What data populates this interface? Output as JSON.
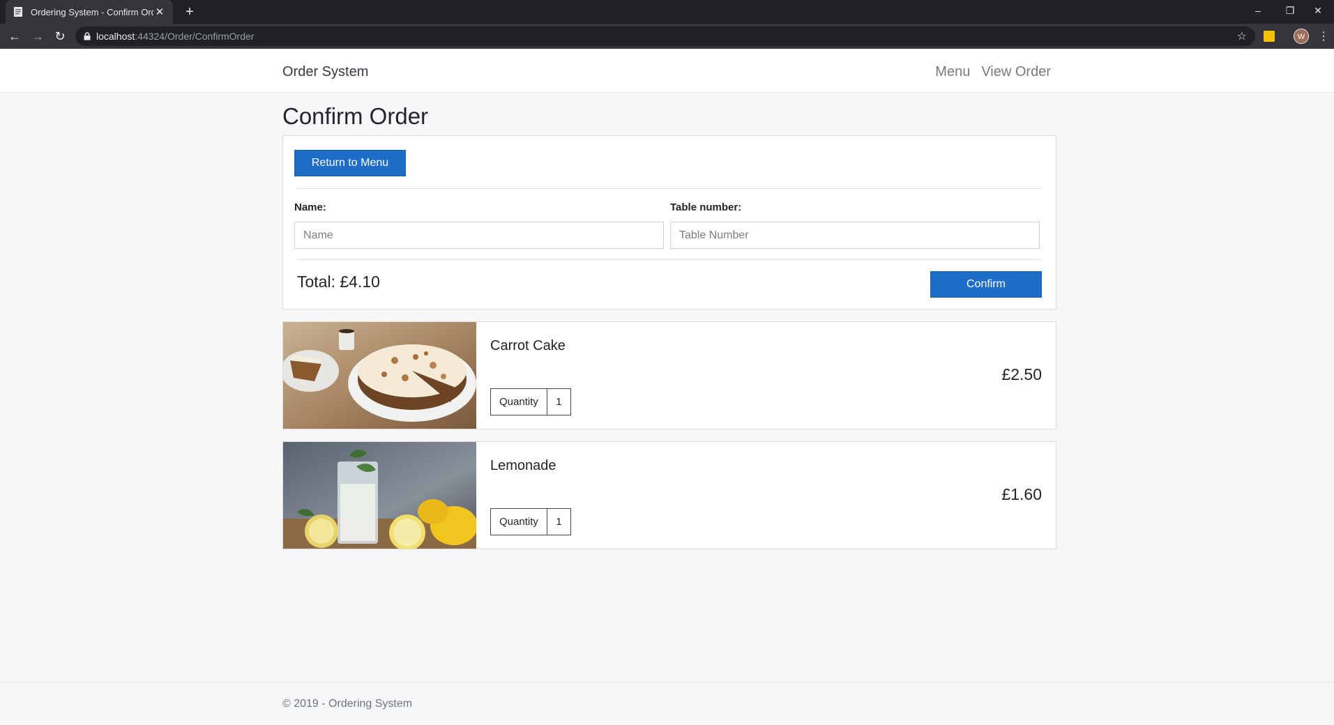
{
  "browser": {
    "tab_title": "Ordering System - Confirm Order",
    "url_host": "localhost",
    "url_rest": ":44324/Order/ConfirmOrder",
    "profile_initial": "W"
  },
  "navbar": {
    "brand": "Order System",
    "links": [
      "Menu",
      "View Order"
    ]
  },
  "page": {
    "title": "Confirm Order",
    "return_button": "Return to Menu",
    "name_label": "Name:",
    "name_placeholder": "Name",
    "table_label": "Table number:",
    "table_placeholder": "Table Number",
    "total": "Total: £4.10",
    "confirm_button": "Confirm"
  },
  "items": [
    {
      "name": "Carrot Cake",
      "price": "£2.50",
      "quantity_label": "Quantity",
      "quantity": "1"
    },
    {
      "name": "Lemonade",
      "price": "£1.60",
      "quantity_label": "Quantity",
      "quantity": "1"
    }
  ],
  "footer": {
    "text": "© 2019 - Ordering System"
  },
  "colors": {
    "primary": "#1e6ec8",
    "background": "#f7f7f9"
  }
}
